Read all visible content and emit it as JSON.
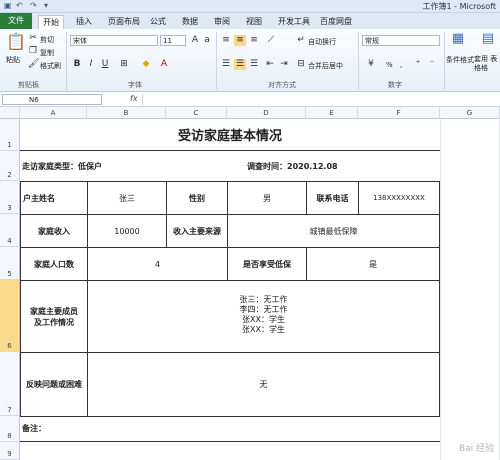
{
  "app": {
    "title": "工作簿1 - Microsoft"
  },
  "tabs": [
    "文件",
    "开始",
    "插入",
    "页面布局",
    "公式",
    "数据",
    "审阅",
    "视图",
    "开发工具",
    "百度网盘"
  ],
  "ribbon": {
    "paste": "粘贴",
    "cut": "剪切",
    "copy": "复制",
    "format_painter": "格式刷",
    "clipboard_group": "剪贴板",
    "font_name": "宋体",
    "font_size": "11",
    "font_group": "字体",
    "wrap_text": "自动换行",
    "merge_center": "合并后居中",
    "align_group": "对齐方式",
    "number_format": "常规",
    "number_group": "数字",
    "cond_format": "条件格式",
    "table_format": "套用 表格格",
    "percent": "%",
    "comma": ","
  },
  "formula_bar": {
    "name_box": "N6",
    "fx": "fx",
    "value": ""
  },
  "columns": [
    "A",
    "B",
    "C",
    "D",
    "E",
    "F",
    "G"
  ],
  "rows": [
    "1",
    "2",
    "3",
    "4",
    "5",
    "6",
    "7",
    "8",
    "9"
  ],
  "sheet": {
    "title": "受访家庭基本情况",
    "visit_type": "走访家庭类型：低保户",
    "visit_time": "调查时间：2020.12.08",
    "head_name_label": "户主姓名",
    "head_name": "张三",
    "gender_label": "性别",
    "gender": "男",
    "phone_label": "联系电话",
    "phone": "138XXXXXXXX",
    "income_label": "家庭收入",
    "income": "10000",
    "income_source_label": "收入主要来源",
    "income_source": "城镇最低保障",
    "members_label": "家庭人口数",
    "members": "4",
    "subsidy_label": "是否享受低保",
    "subsidy": "是",
    "work_label_1": "家庭主要成员",
    "work_label_2": "及工作情况",
    "work_lines": [
      "张三：无工作",
      "李四：无工作",
      "张XX：学生",
      "张XX：学生"
    ],
    "issues_label": "反映问题或困难",
    "issues": "无",
    "remarks_label": "备注："
  },
  "watermark": "Bai 经验"
}
